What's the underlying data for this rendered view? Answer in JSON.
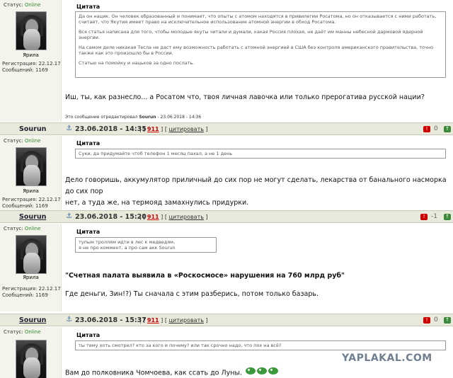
{
  "post0": {
    "status_label": "Статус:",
    "status_value": "Online",
    "username": "Ярила",
    "reg_label": "Регистрация:",
    "reg_date": "22.12.17",
    "msgs_label": "Сообщений:",
    "msgs_count": "1169",
    "quote_title": "Цитата",
    "quote_p1": "Да он нацик. Он человек образованный и понимает, что опыты с атомом находятся в привилегии Росатома, но он отказывается с ними работать, считает, что Якутия имеет право на исключительное использование атомной энергии в обход Росатома.",
    "quote_p2": "Вся статья написана для того, чтобы молодые якуты читали и думали, какая Россия плохая, не даёт им манны небесной дармовой ядерной энергии.",
    "quote_p3": "На самом деле никакая Тесла не даст ему возможность работать с атомной энергией в США без контроля американского правительства, точно также как это произошло бы в России.",
    "quote_p4": "Статью на помойку и нацьков за одно послать.",
    "message": "Иш, ты, как разнесло... а Росатом что, твоя личная лавочка или только прерогатива русской нации?",
    "edited_prefix": "Это сообщение отредактировал",
    "edited_user": "Sourun",
    "edited_suffix": "- 23.06.2018 - 14:36"
  },
  "post1": {
    "author": "Sourun",
    "anchor": "⚓",
    "date": "23.06.2018 - 14:35",
    "link_911": "911",
    "link_cite": "цитировать",
    "rate_neg": "!",
    "score": "0",
    "rate_pos": "↑",
    "status_label": "Статус:",
    "status_value": "Online",
    "username": "Ярила",
    "reg_label": "Регистрация:",
    "reg_date": "22.12.17",
    "msgs_label": "Сообщений:",
    "msgs_count": "1169",
    "quote_title": "Цитата",
    "quote_text": "Суки, да придумайте чтоб телефон 1 месяц пахал, а не 1 день",
    "message_l1": "Дело говоришь, аккумулятор приличный до сих пор не могут сделать, лекарства от банального насморка до сих пор",
    "message_l2": "нет, а туда же, на термояд замахнулись придурки."
  },
  "post2": {
    "author": "Sourun",
    "anchor": "⚓",
    "date": "23.06.2018 - 15:20",
    "link_911": "911",
    "link_cite": "цитировать",
    "rate_neg": "!",
    "score": "-1",
    "rate_pos": "↑",
    "status_label": "Статус:",
    "status_value": "Online",
    "username": "Ярила",
    "reg_label": "Регистрация:",
    "reg_date": "22.12.17",
    "msgs_label": "Сообщений:",
    "msgs_count": "1169",
    "quote_title": "Цитата",
    "quote_l1": "тупым троллям идти в лес к медведям,",
    "quote_l2": "я не про коммент, а про сам акк Sourun",
    "headline": "\"Счетная палата выявила в «Роскосмосе» нарушения на 760 млрд руб\"",
    "message": "Где деньги, Зин!?) Ты сначала с этим разберись, потом только базарь."
  },
  "post3": {
    "author": "Sourun",
    "anchor": "⚓",
    "date": "23.06.2018 - 15:37",
    "link_911": "911",
    "link_cite": "цитировать",
    "rate_neg": "!",
    "score": "0",
    "rate_pos": "↑",
    "status_label": "Статус:",
    "status_value": "Online",
    "quote_title": "Цитата",
    "quote_text": "ты тему хоть смотрел? кто за кого и почему? или так срочно надо, что пох на всё?",
    "message": "Вам до полковника Чомчоева, как ссать до Луны."
  },
  "watermark": "YAPLAKAL.COM"
}
